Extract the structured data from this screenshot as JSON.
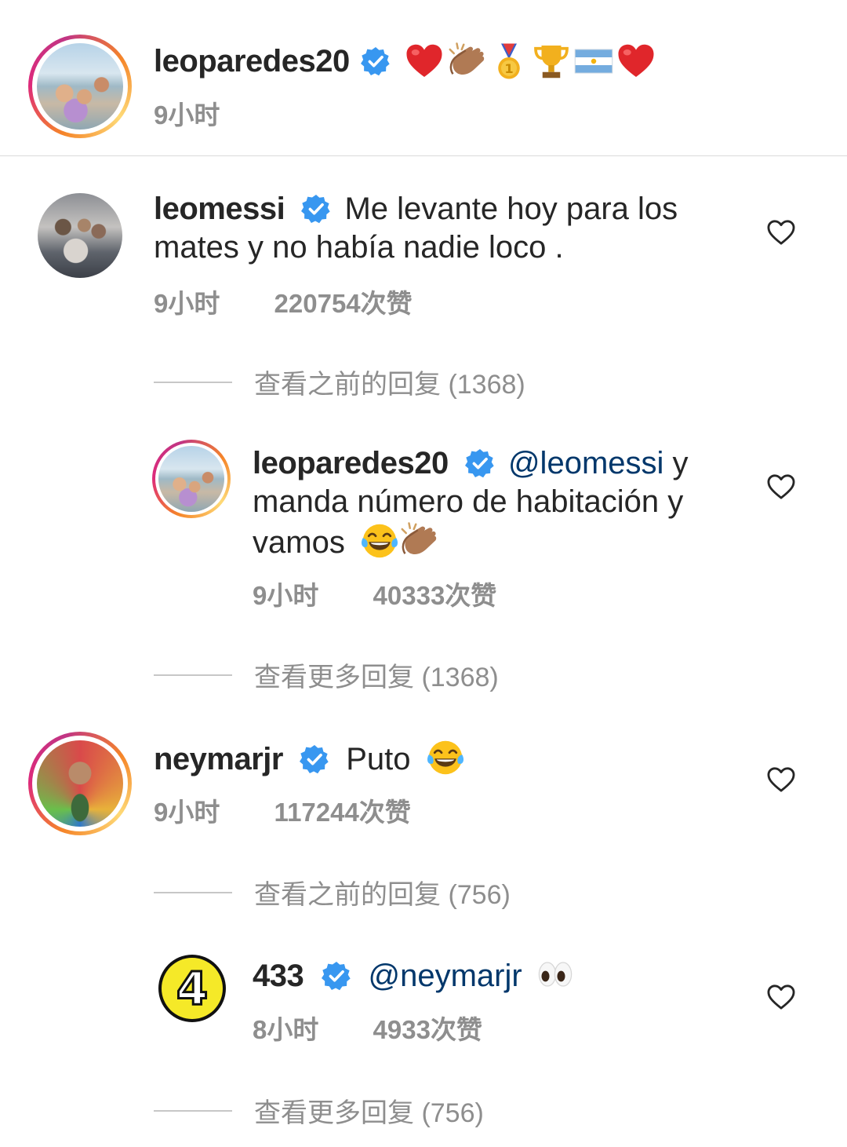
{
  "header": {
    "username": "leoparedes20",
    "caption_emojis": [
      "heart-emoji",
      "clapping-hands-emoji",
      "gold-medal-emoji",
      "trophy-emoji",
      "argentina-flag-emoji",
      "heart-emoji"
    ],
    "time": "9小时"
  },
  "comments": [
    {
      "username": "leomessi",
      "text": "Me levante hoy para los mates y no había nadie loco .",
      "time": "9小时",
      "likes": "220754次赞",
      "view_replies": "查看之前的回复 (1368)",
      "reply": {
        "username": "leoparedes20",
        "mention": "@leomessi",
        "text_after_mention": " y manda número de habitación y vamos",
        "emojis": [
          "joy-emoji",
          "clapping-hands-emoji"
        ],
        "time": "9小时",
        "likes": "40333次赞"
      },
      "view_more_replies": "查看更多回复 (1368)"
    },
    {
      "username": "neymarjr",
      "text": "Puto",
      "emojis": [
        "joy-emoji"
      ],
      "time": "9小时",
      "likes": "117244次赞",
      "view_replies": "查看之前的回复 (756)",
      "reply": {
        "username": "433",
        "mention": "@neymarjr",
        "emojis": [
          "eyes-emoji"
        ],
        "time": "8小时",
        "likes": "4933次赞",
        "logo_text": "4"
      },
      "view_more_replies": "查看更多回复 (756)"
    }
  ],
  "colors": {
    "verified": "#3897f0",
    "mention": "#00376b",
    "meta": "#8e8e8e",
    "text": "#262626",
    "logo_yellow": "#f5e928"
  }
}
